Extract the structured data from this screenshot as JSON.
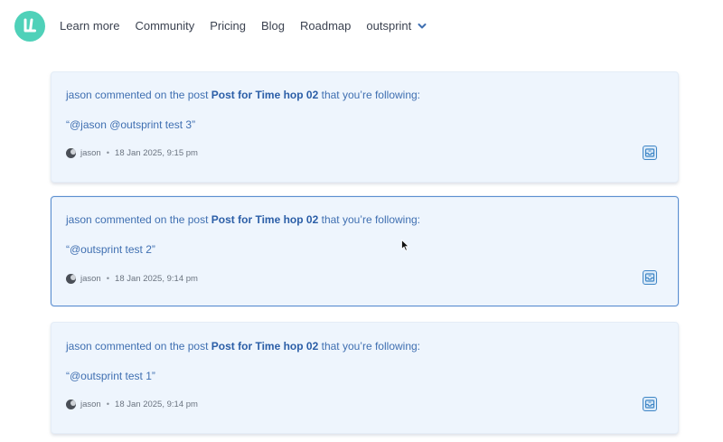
{
  "header": {
    "logo_text": "LL",
    "nav": [
      "Learn more",
      "Community",
      "Pricing",
      "Blog",
      "Roadmap",
      "outsprint"
    ]
  },
  "colors": {
    "accent": "#4fd1b9",
    "card_bg": "#eef5fd",
    "link": "#3f6fb1",
    "active_border": "#5b8fd0"
  },
  "notifications": [
    {
      "user": "jason",
      "action": "commented on the post",
      "post": "Post for Time hop 02",
      "suffix": "that you’re following:",
      "quote": "“@jason @outsprint test 3”",
      "author": "jason",
      "separator": "•",
      "timestamp": "18 Jan 2025, 9:15 pm",
      "icon": "inbox-icon"
    },
    {
      "user": "jason",
      "action": "commented on the post",
      "post": "Post for Time hop 02",
      "suffix": "that you’re following:",
      "quote": "“@outsprint test 2”",
      "author": "jason",
      "separator": "•",
      "timestamp": "18 Jan 2025, 9:14 pm",
      "icon": "inbox-icon"
    },
    {
      "user": "jason",
      "action": "commented on the post",
      "post": "Post for Time hop 02",
      "suffix": "that you’re following:",
      "quote": "“@outsprint test 1”",
      "author": "jason",
      "separator": "•",
      "timestamp": "18 Jan 2025, 9:14 pm",
      "icon": "inbox-icon"
    }
  ]
}
